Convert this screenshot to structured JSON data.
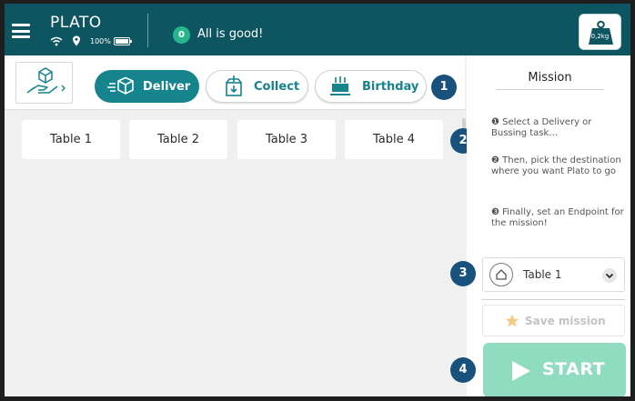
{
  "header": {
    "app_name": "PLATO",
    "battery_level": "100%",
    "status_count": "0",
    "status_text": "All is good!",
    "payload_weight": "0,2kg"
  },
  "tasks": {
    "deliver_label": "Deliver",
    "collect_label": "Collect",
    "birthday_label": "Birthday",
    "active": "Deliver"
  },
  "tables": [
    "Table 1",
    "Table 2",
    "Table 3",
    "Table 4"
  ],
  "guide": {
    "b1": "1",
    "b2": "2",
    "b3": "3",
    "b4": "4"
  },
  "mission": {
    "title": "Mission",
    "step1": "❶ Select a Delivery or Bussing task…",
    "step2": "❷ Then, pick the destination where you want Plato to go",
    "step3": "❸ Finally, set an Endpoint for the mission!",
    "endpoint": "Table 1",
    "save_label": "Save mission",
    "start_label": "START"
  },
  "colors": {
    "header_bg": "#0d5560",
    "accent": "#16848c",
    "ok_green": "#27b58e",
    "guide_badge": "#18527c",
    "start_disabled": "#8fdcc1"
  }
}
